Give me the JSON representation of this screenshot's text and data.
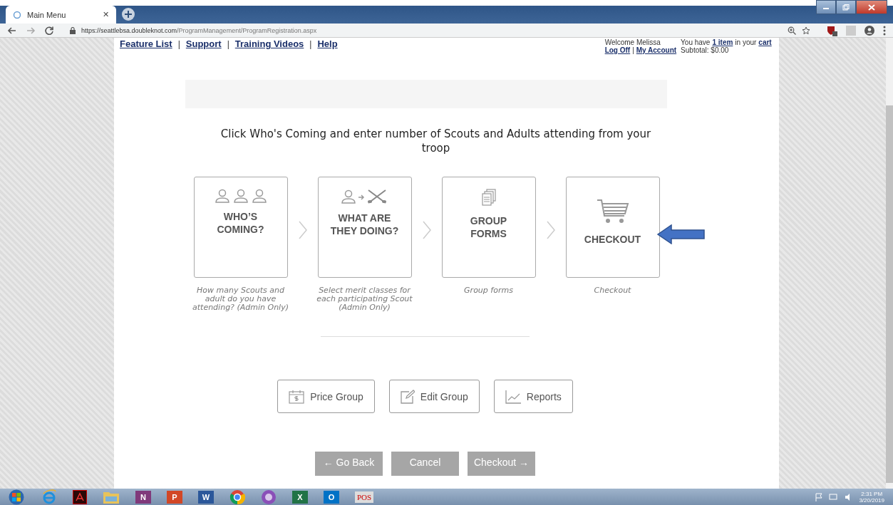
{
  "browser": {
    "tab_title": "Main Menu",
    "tab_close": "✕",
    "url_host": "https://seattlebsa.doubleknot.com",
    "url_path": "/ProgramManagement/ProgramRegistration.aspx"
  },
  "header": {
    "links": [
      "Feature List",
      "Support",
      "Training Videos",
      "Help"
    ],
    "link_separators": [
      "|",
      "|",
      "|"
    ],
    "welcome": "Welcome Melissa",
    "account_links": [
      "Log Off",
      "My Account"
    ],
    "account_separator": "|",
    "cart_prefix": "You have",
    "cart_count": "1 item",
    "cart_middle": "in your",
    "cart_link": "cart",
    "subtotal": "Subtotal: $0.00"
  },
  "instruction": "Click Who's Coming and enter number of Scouts and Adults attending from your troop",
  "steps": [
    {
      "kind": "people",
      "title": "WHO’S COMING?",
      "description": "How many Scouts and adult do you have attending? (Admin Only)"
    },
    {
      "kind": "person-paddles",
      "title": "WHAT ARE THEY DOING?",
      "description": "Select merit classes for each participating Scout (Admin Only)"
    },
    {
      "kind": "forms",
      "title": "GROUP FORMS",
      "description": "Group forms"
    },
    {
      "kind": "cart",
      "title": "CHECKOUT",
      "description": "Checkout"
    }
  ],
  "actions": [
    {
      "kind": "calendar",
      "label": "Price Group"
    },
    {
      "kind": "edit",
      "label": "Edit Group"
    },
    {
      "kind": "chart",
      "label": "Reports"
    }
  ],
  "nav_buttons": [
    "← Go Back",
    "Cancel",
    "Checkout →"
  ],
  "taskbar": [
    {
      "kind": "start"
    },
    {
      "kind": "ie"
    },
    {
      "kind": "acrobat"
    },
    {
      "kind": "folder"
    },
    {
      "kind": "app",
      "label": "N",
      "color": "#80397b"
    },
    {
      "kind": "app",
      "label": "P",
      "color": "#d24726"
    },
    {
      "kind": "app",
      "label": "W",
      "color": "#2b579a"
    },
    {
      "kind": "chrome"
    },
    {
      "kind": "photo"
    },
    {
      "kind": "app",
      "label": "X",
      "color": "#217346"
    },
    {
      "kind": "app",
      "label": "O",
      "color": "#0072c6"
    },
    {
      "kind": "pos",
      "label": "POS"
    }
  ],
  "clock": {
    "time": "2:31 PM",
    "date": "3/20/2019"
  }
}
